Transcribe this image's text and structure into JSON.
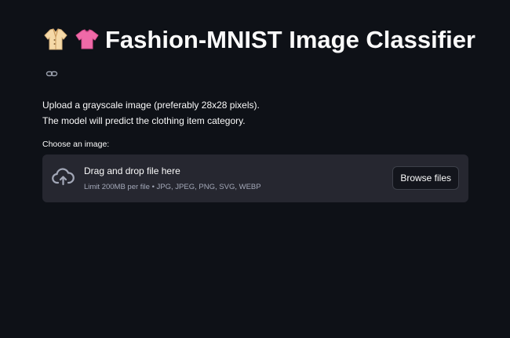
{
  "header": {
    "title": "Fashion-MNIST Image Classifier",
    "icons": [
      "coat-emoji-icon",
      "tshirt-emoji-icon",
      "link-icon"
    ]
  },
  "description": {
    "line1": "Upload a grayscale image (preferably 28x28 pixels).",
    "line2": "The model will predict the clothing item category."
  },
  "uploader": {
    "label": "Choose an image:",
    "drop_text": "Drag and drop file here",
    "limit_text": "Limit 200MB per file • JPG, JPEG, PNG, SVG, WEBP",
    "browse_label": "Browse files"
  },
  "colors": {
    "background": "#0e1117",
    "dropzone": "#262730",
    "text": "#fafafa",
    "muted": "#a3a8b8"
  }
}
